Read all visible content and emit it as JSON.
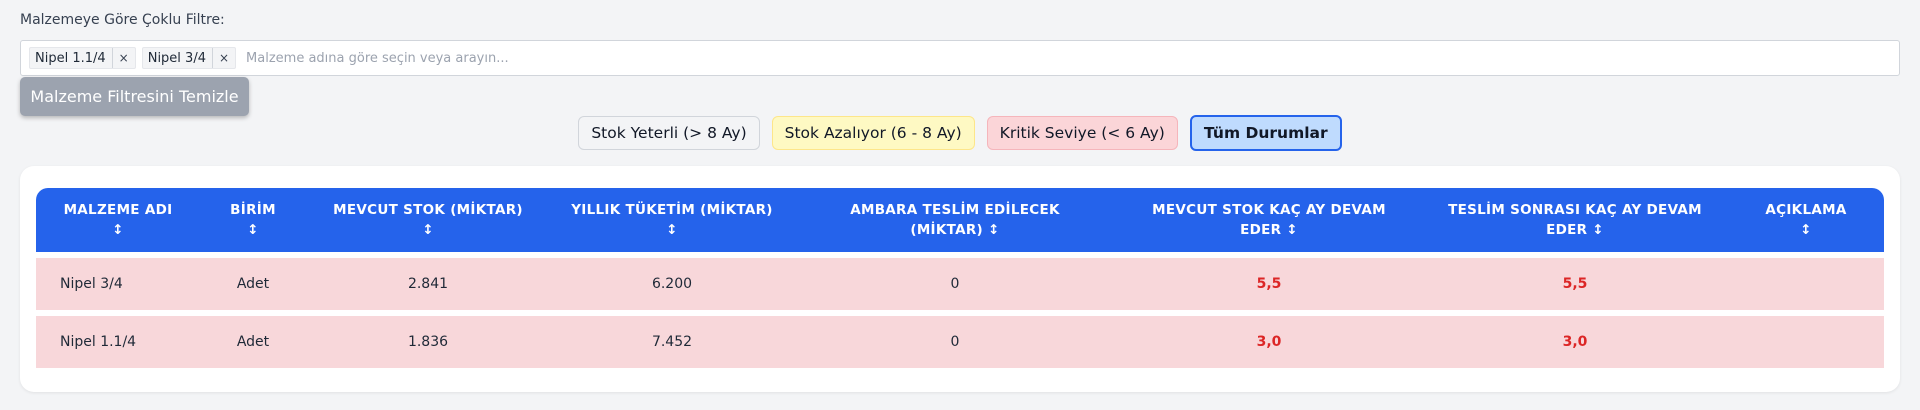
{
  "filter": {
    "label": "Malzemeye Göre Çoklu Filtre:",
    "chips": [
      {
        "label": "Nipel 1.1/4",
        "remove": "×"
      },
      {
        "label": "Nipel 3/4",
        "remove": "×"
      }
    ],
    "placeholder": "Malzeme adına göre seçin veya arayın...",
    "clear_label": "Malzeme Filtresini Temizle"
  },
  "status_filters": {
    "ok": "Stok Yeterli (> 8 Ay)",
    "warn": "Stok Azalıyor (6 - 8 Ay)",
    "crit": "Kritik Seviye (< 6 Ay)",
    "all": "Tüm Durumlar",
    "active": "all"
  },
  "table": {
    "headers": [
      {
        "line1": "MALZEME ADI",
        "line2": "↕"
      },
      {
        "line1": "BİRİM",
        "line2": "↕"
      },
      {
        "line1": "MEVCUT STOK (MİKTAR)",
        "line2": "↕"
      },
      {
        "line1": "YILLIK TÜKETİM (MİKTAR)",
        "line2": "↕"
      },
      {
        "line1": "AMBARA TESLİM EDİLECEK",
        "line2": "(MİKTAR) ↕"
      },
      {
        "line1": "MEVCUT STOK KAÇ AY DEVAM",
        "line2": "EDER ↕"
      },
      {
        "line1": "TESLİM SONRASI KAÇ AY DEVAM",
        "line2": "EDER ↕"
      },
      {
        "line1": "AÇIKLAMA",
        "line2": "↕"
      }
    ],
    "rows": [
      {
        "name": "Nipel 3/4",
        "unit": "Adet",
        "stock": "2.841",
        "annual": "6.200",
        "incoming": "0",
        "months_now": "5,5",
        "months_after": "5,5",
        "note": ""
      },
      {
        "name": "Nipel 1.1/4",
        "unit": "Adet",
        "stock": "1.836",
        "annual": "7.452",
        "incoming": "0",
        "months_now": "3,0",
        "months_after": "3,0",
        "note": ""
      }
    ]
  },
  "colors": {
    "header_blue": "#2563eb",
    "critical_row": "#f8d7da",
    "critical_text": "#dc2626"
  }
}
